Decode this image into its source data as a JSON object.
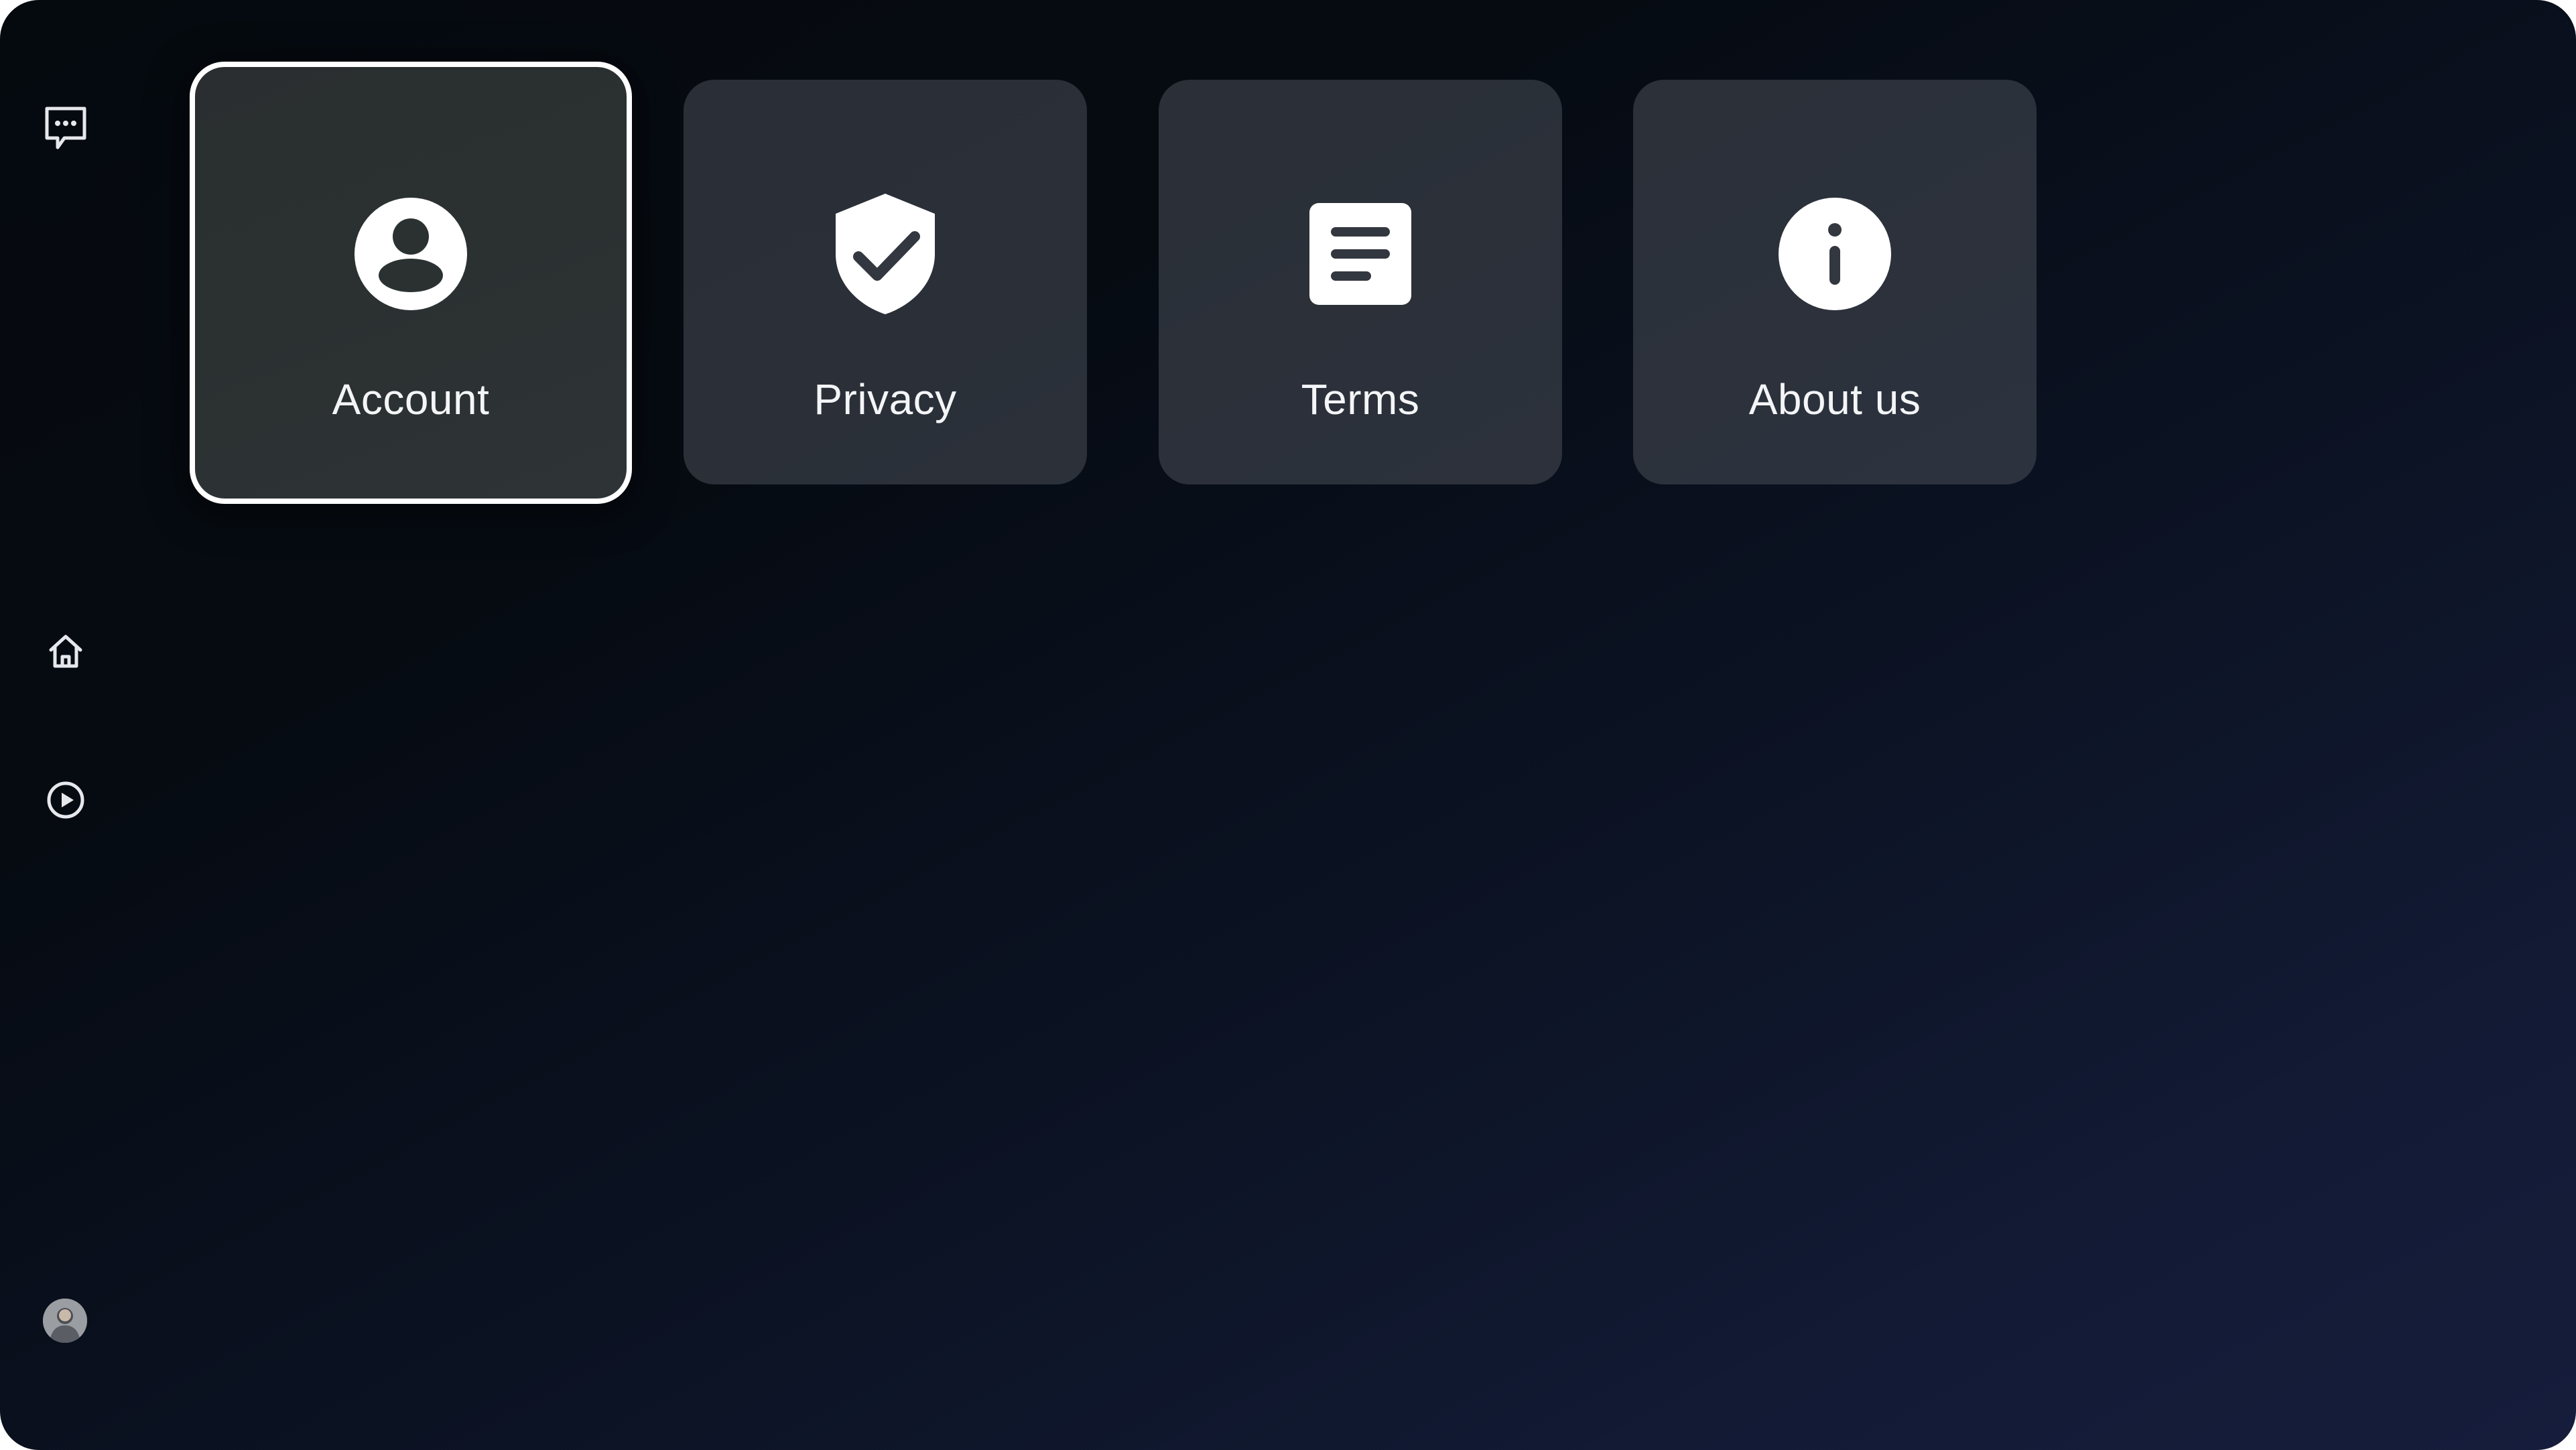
{
  "sidebar": {
    "items": [
      {
        "name": "feedback",
        "icon": "feedback-chat-icon"
      },
      {
        "name": "home",
        "icon": "home-icon"
      },
      {
        "name": "play",
        "icon": "play-circle-icon"
      },
      {
        "name": "profile",
        "icon": "user-avatar"
      }
    ]
  },
  "settings": {
    "cards": [
      {
        "label": "Account",
        "icon": "account-circle-icon",
        "focused": true
      },
      {
        "label": "Privacy",
        "icon": "shield-check-icon",
        "focused": false
      },
      {
        "label": "Terms",
        "icon": "document-text-icon",
        "focused": false
      },
      {
        "label": "About us",
        "icon": "info-icon",
        "focused": false
      }
    ]
  },
  "colors": {
    "background_start": "#050a0f",
    "background_end": "#161d3c",
    "card_background": "#33373f",
    "focus_border": "#ffffff",
    "text": "#f4f5f7"
  }
}
